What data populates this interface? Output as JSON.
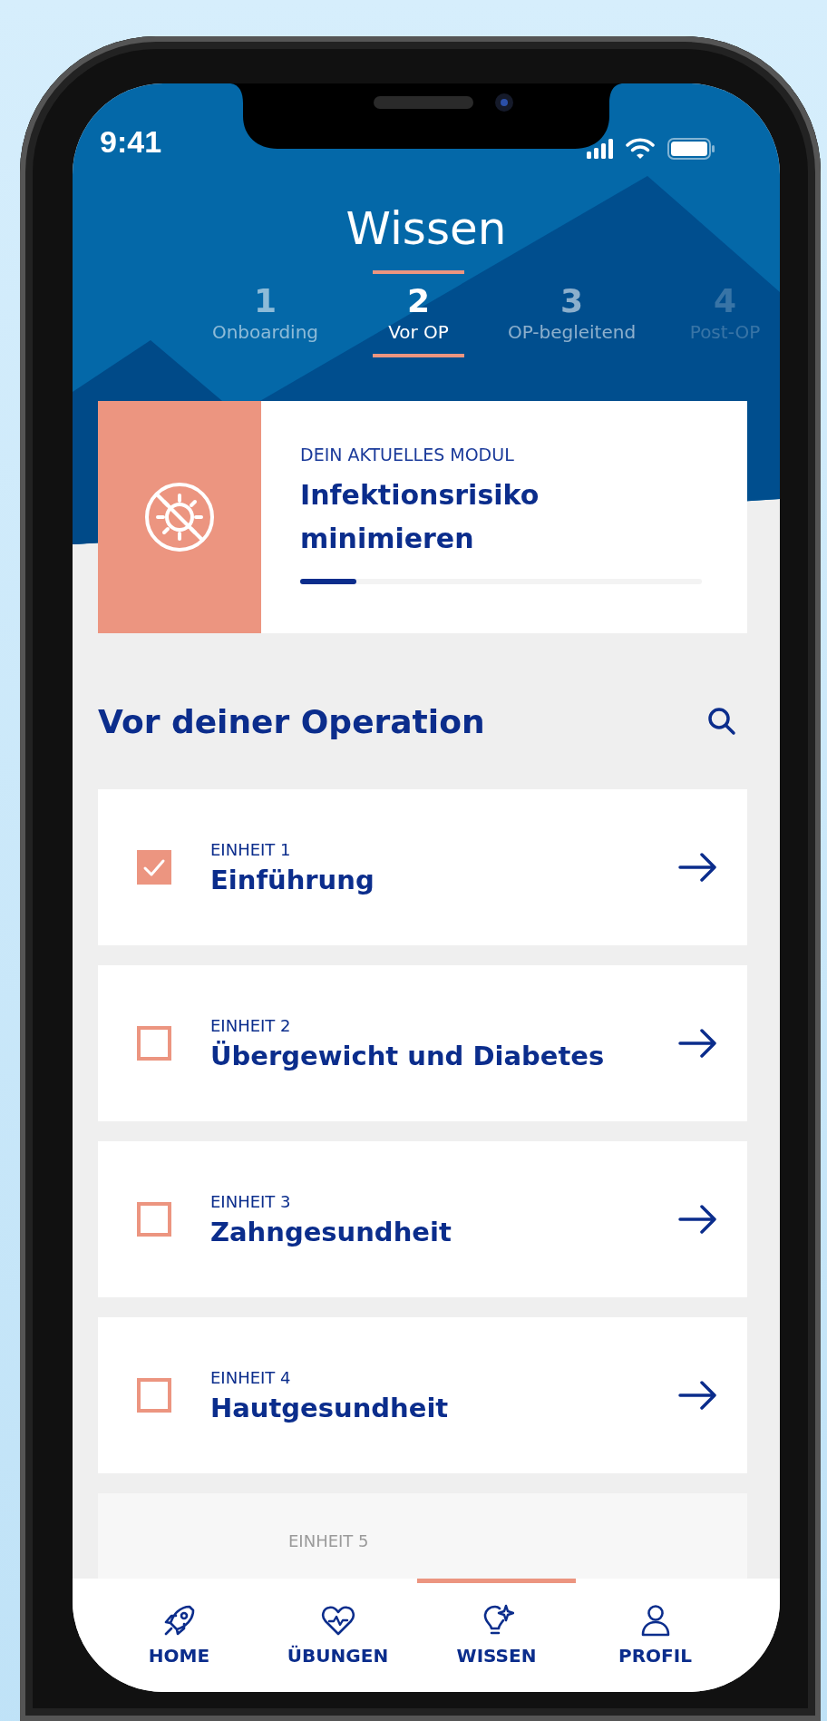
{
  "status_bar": {
    "time": "9:41"
  },
  "title": "Wissen",
  "steps": [
    {
      "number": "1",
      "label": "Onboarding",
      "selected": false,
      "disabled": false
    },
    {
      "number": "2",
      "label": "Vor OP",
      "selected": true,
      "disabled": false
    },
    {
      "number": "3",
      "label": "OP-begleitend",
      "selected": false,
      "disabled": false
    },
    {
      "number": "4",
      "label": "Post-OP",
      "selected": false,
      "disabled": true
    }
  ],
  "current_module": {
    "eyebrow": "DEIN AKTUELLES MODUL",
    "title": "Infektionsrisiko minimieren",
    "level": 0.14
  },
  "section": {
    "title": "Vor deiner Operation"
  },
  "units": [
    {
      "eyebrow": "EINHEIT 1",
      "title": "Einführung",
      "checked": true
    },
    {
      "eyebrow": "EINHEIT 2",
      "title": "Übergewicht und Diabetes",
      "checked": false
    },
    {
      "eyebrow": "EINHEIT 3",
      "title": "Zahngesundheit",
      "checked": false
    },
    {
      "eyebrow": "EINHEIT 4",
      "title": "Hautgesundheit",
      "checked": false
    }
  ],
  "partial_unit": {
    "eyebrow": "EINHEIT 5"
  },
  "nav": [
    {
      "kind": "rocket",
      "label": "HOME",
      "selected": false
    },
    {
      "kind": "heart",
      "label": "ÜBUNGEN",
      "selected": false
    },
    {
      "kind": "bulb",
      "label": "WISSEN",
      "selected": true
    },
    {
      "kind": "person",
      "label": "PROFIL",
      "selected": false
    }
  ]
}
